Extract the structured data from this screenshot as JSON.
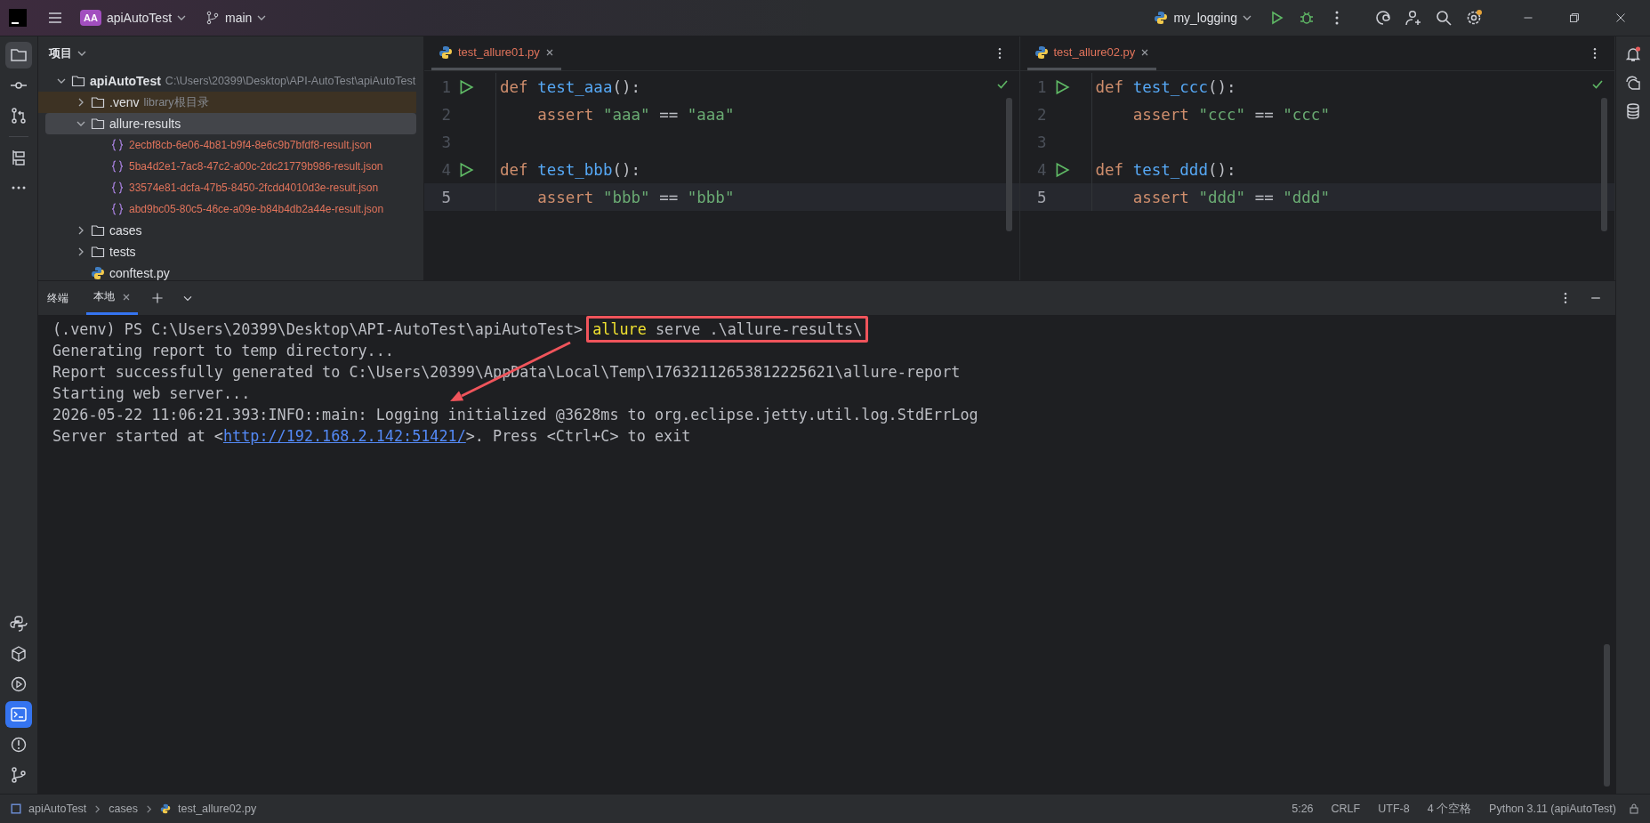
{
  "toolbar": {
    "project_badge": "AA",
    "project": "apiAutoTest",
    "branch": "main",
    "run_config": "my_logging"
  },
  "left_tools": [
    {
      "kind": "folder",
      "selected": true
    },
    {
      "kind": "commit",
      "selected": false
    },
    {
      "kind": "pull",
      "selected": false
    },
    {
      "kind": "structure",
      "selected": false
    },
    {
      "kind": "more",
      "selected": false
    }
  ],
  "left_tools_bottom": [
    {
      "kind": "python",
      "selected": false
    },
    {
      "kind": "packages",
      "selected": false
    },
    {
      "kind": "services",
      "selected": false
    },
    {
      "kind": "terminal",
      "selected": true
    },
    {
      "kind": "problems",
      "selected": false
    },
    {
      "kind": "git",
      "selected": false
    }
  ],
  "project_panel": {
    "title": "项目",
    "tree": [
      {
        "label": "apiAutoTest",
        "kind": "root",
        "path": "C:\\Users\\20399\\Desktop\\API-AutoTest\\apiAutoTest",
        "expanded": true,
        "selected": false,
        "children": [
          {
            "label": ".venv",
            "kind": "folder",
            "hint": "library根目录",
            "expanded": false,
            "selected": false
          },
          {
            "label": "allure-results",
            "kind": "folder",
            "expanded": true,
            "selected": true,
            "children": [
              {
                "label": "2ecbf8cb-6e06-4b81-b9f4-8e6c9b7bfdf8-result.json",
                "kind": "json",
                "selected": false
              },
              {
                "label": "5ba4d2e1-7ac8-47c2-a00c-2dc21779b986-result.json",
                "kind": "json",
                "selected": false
              },
              {
                "label": "33574e81-dcfa-47b5-8450-2fcdd4010d3e-result.json",
                "kind": "json",
                "selected": false
              },
              {
                "label": "abd9bc05-80c5-46ce-a09e-b84b4db2a44e-result.json",
                "kind": "json",
                "selected": false
              }
            ]
          },
          {
            "label": "cases",
            "kind": "folder",
            "expanded": false,
            "selected": false
          },
          {
            "label": "tests",
            "kind": "folder",
            "expanded": false,
            "selected": false
          },
          {
            "label": "conftest.py",
            "kind": "python",
            "selected": false
          }
        ]
      }
    ]
  },
  "editors": [
    {
      "tab": "test_allure01.py",
      "lines": [
        {
          "number": "1",
          "run": true,
          "current": false,
          "tokens": [
            {
              "kind": "keyword",
              "text": "def "
            },
            {
              "kind": "function",
              "text": "test_aaa"
            },
            {
              "kind": "plain",
              "text": "():"
            }
          ]
        },
        {
          "number": "2",
          "run": false,
          "current": false,
          "tokens": [
            {
              "kind": "keyword",
              "text": "    assert "
            },
            {
              "kind": "string",
              "text": "\"aaa\""
            },
            {
              "kind": "plain",
              "text": " == "
            },
            {
              "kind": "string",
              "text": "\"aaa\""
            }
          ]
        },
        {
          "number": "3",
          "run": false,
          "current": false
        },
        {
          "number": "4",
          "run": true,
          "current": false,
          "tokens": [
            {
              "kind": "keyword",
              "text": "def "
            },
            {
              "kind": "function",
              "text": "test_bbb"
            },
            {
              "kind": "plain",
              "text": "():"
            }
          ]
        },
        {
          "number": "5",
          "run": false,
          "current": true,
          "tokens": [
            {
              "kind": "keyword",
              "text": "    assert "
            },
            {
              "kind": "string",
              "text": "\"bbb\""
            },
            {
              "kind": "plain",
              "text": " == "
            },
            {
              "kind": "string",
              "text": "\"bbb\""
            }
          ]
        }
      ]
    },
    {
      "tab": "test_allure02.py",
      "lines": [
        {
          "number": "1",
          "run": true,
          "current": false,
          "tokens": [
            {
              "kind": "keyword",
              "text": "def "
            },
            {
              "kind": "function",
              "text": "test_ccc"
            },
            {
              "kind": "plain",
              "text": "():"
            }
          ]
        },
        {
          "number": "2",
          "run": false,
          "current": false,
          "tokens": [
            {
              "kind": "keyword",
              "text": "    assert "
            },
            {
              "kind": "string",
              "text": "\"ccc\""
            },
            {
              "kind": "plain",
              "text": " == "
            },
            {
              "kind": "string",
              "text": "\"ccc\""
            }
          ]
        },
        {
          "number": "3",
          "run": false,
          "current": false
        },
        {
          "number": "4",
          "run": true,
          "current": false,
          "tokens": [
            {
              "kind": "keyword",
              "text": "def "
            },
            {
              "kind": "function",
              "text": "test_ddd"
            },
            {
              "kind": "plain",
              "text": "():"
            }
          ]
        },
        {
          "number": "5",
          "run": false,
          "current": true,
          "tokens": [
            {
              "kind": "keyword",
              "text": "    assert "
            },
            {
              "kind": "string",
              "text": "\"ddd\""
            },
            {
              "kind": "plain",
              "text": " == "
            },
            {
              "kind": "string",
              "text": "\"ddd\""
            }
          ]
        }
      ]
    }
  ],
  "terminal": {
    "title": "终端",
    "tabs": [
      {
        "label": "本地",
        "selected": true
      }
    ],
    "lines": [
      {
        "parts": [
          {
            "kind": "text",
            "text": "(.venv) PS C:\\Users\\20399\\Desktop\\API-AutoTest\\apiAutoTest> "
          },
          {
            "kind": "command",
            "text": "allure",
            "boxed": true
          },
          {
            "kind": "text",
            "text": " serve .\\allure-results\\",
            "boxed": true
          }
        ]
      },
      {
        "parts": [
          {
            "kind": "text",
            "text": "Generating report to temp directory..."
          }
        ]
      },
      {
        "parts": [
          {
            "kind": "text",
            "text": "Report successfully generated to C:\\Users\\20399\\AppData\\Local\\Temp\\17632112653812225621\\allure-report"
          }
        ]
      },
      {
        "parts": [
          {
            "kind": "text",
            "text": "Starting web server..."
          }
        ]
      },
      {
        "parts": [
          {
            "kind": "text",
            "text": "2026-05-22 11:06:21.393:INFO::main: Logging initialized @3628ms to org.eclipse.jetty.util.log.StdErrLog"
          }
        ]
      },
      {
        "parts": [
          {
            "kind": "text",
            "text": "Server started at <"
          },
          {
            "kind": "link",
            "text": "http://192.168.2.142:51421/"
          },
          {
            "kind": "text",
            "text": ">. Press <Ctrl+C> to exit"
          }
        ]
      }
    ],
    "annotations": [
      {
        "kind": "arrow"
      }
    ]
  },
  "status_bar": {
    "breadcrumbs": [
      "apiAutoTest",
      "cases",
      "test_allure02.py"
    ],
    "items": [
      "5:26",
      "CRLF",
      "UTF-8",
      "4 个空格",
      "Python 3.11 (apiAutoTest)"
    ]
  }
}
